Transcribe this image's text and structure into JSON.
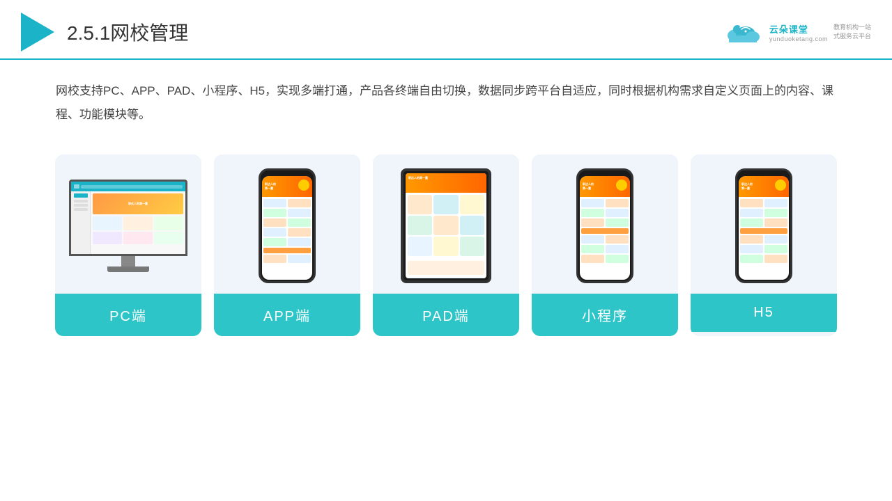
{
  "header": {
    "title_prefix": "2.5.1",
    "title_main": "网校管理",
    "brand": {
      "name": "云朵课堂",
      "url": "yunduoketang.com",
      "slogan_line1": "教育机构一站",
      "slogan_line2": "式服务云平台"
    }
  },
  "description": {
    "text": "网校支持PC、APP、PAD、小程序、H5，实现多端打通，产品各终端自由切换，数据同步跨平台自适应，同时根据机构需求自定义页面上的内容、课程、功能模块等。"
  },
  "cards": [
    {
      "id": "pc",
      "label": "PC端",
      "device": "pc"
    },
    {
      "id": "app",
      "label": "APP端",
      "device": "phone"
    },
    {
      "id": "pad",
      "label": "PAD端",
      "device": "tablet"
    },
    {
      "id": "miniprogram",
      "label": "小程序",
      "device": "phone"
    },
    {
      "id": "h5",
      "label": "H5",
      "device": "phone"
    }
  ]
}
